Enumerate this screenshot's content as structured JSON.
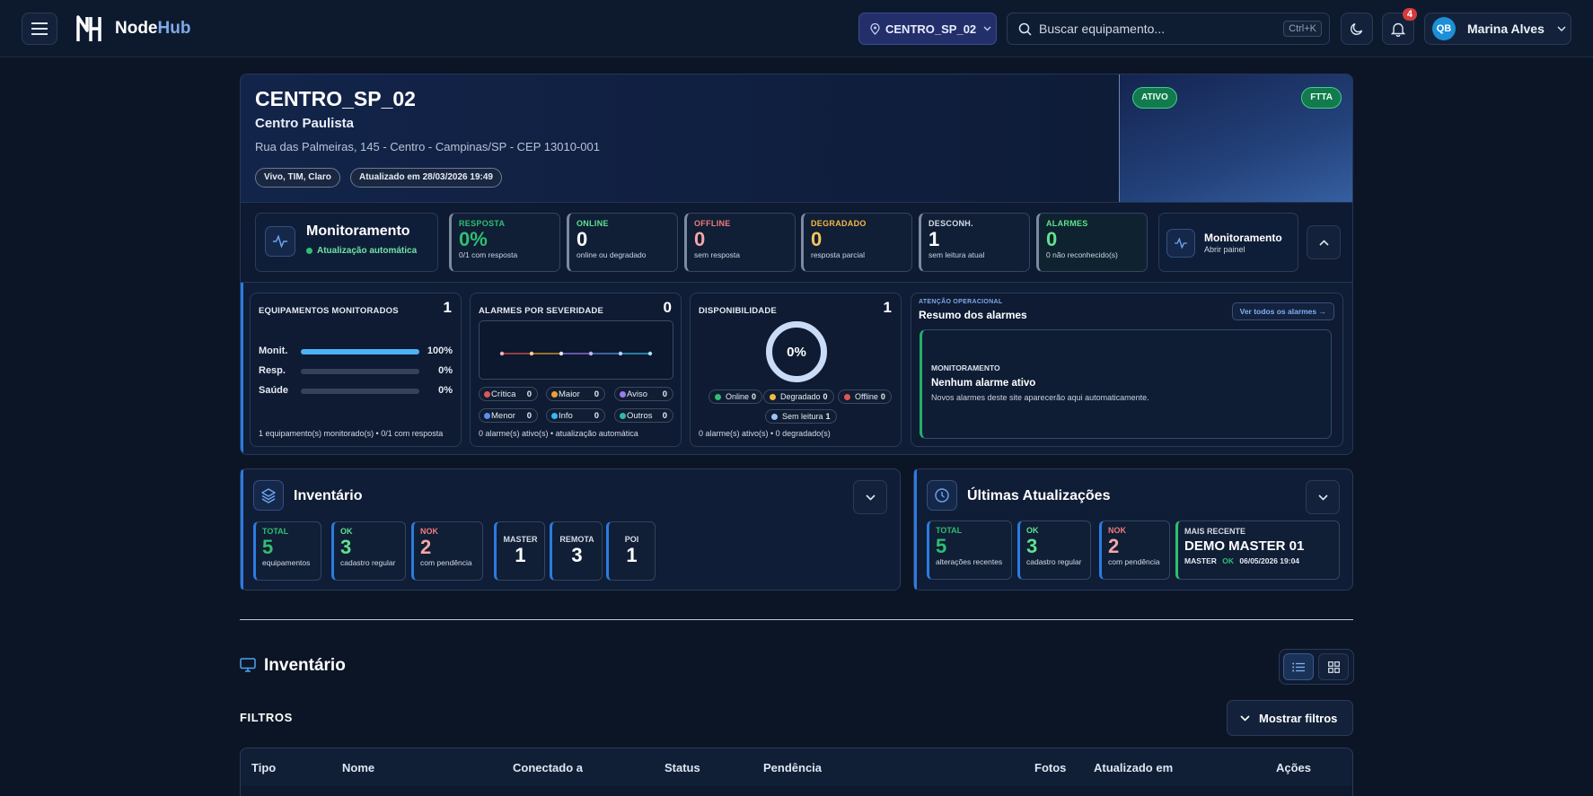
{
  "topbar": {
    "brand_prefix": "Node",
    "brand_suffix": "Hub",
    "site_selector": "CENTRO_SP_02",
    "search_placeholder": "Buscar equipamento...",
    "search_shortcut": "Ctrl+K",
    "notifications_count": "4",
    "user_initials": "QB",
    "user_name": "Marina Alves"
  },
  "site": {
    "code": "CENTRO_SP_02",
    "name": "Centro Paulista",
    "address": "Rua das Palmeiras, 145 - Centro - Campinas/SP - CEP 13010-001",
    "operators": "Vivo, TIM, Claro",
    "updated": "Atualizado em 28/03/2026 19:49",
    "status_badge": "ATIVO",
    "type_badge": "FTTA"
  },
  "monitoring": {
    "title": "Monitoramento",
    "status": "Atualização automática",
    "kpis": [
      {
        "label": "RESPOSTA",
        "value": "0%",
        "sub": "0/1 com resposta",
        "color": "#2fbf71"
      },
      {
        "label": "ONLINE",
        "value": "0",
        "sub": "online ou degradado",
        "color": "#5ee38f"
      },
      {
        "label": "OFFLINE",
        "value": "0",
        "sub": "sem resposta",
        "color": "#f07c7c"
      },
      {
        "label": "DEGRADADO",
        "value": "0",
        "sub": "resposta parcial",
        "color": "#f5b942"
      },
      {
        "label": "DESCONH.",
        "value": "1",
        "sub": "sem leitura atual",
        "color": "#d6dce6"
      },
      {
        "label": "ALARMES",
        "value": "0",
        "sub": "0 não reconhecido(s)",
        "color": "#5ee38f"
      }
    ],
    "panel_title": "Monitoramento",
    "panel_sub": "Abrir painel"
  },
  "equipment": {
    "title": "EQUIPAMENTOS MONITORADOS",
    "count": "1",
    "bars": [
      {
        "label": "Monit.",
        "value": "100%",
        "fraction": 1.0
      },
      {
        "label": "Resp.",
        "value": "0%",
        "fraction": 0
      },
      {
        "label": "Saúde",
        "value": "0%",
        "fraction": 0
      }
    ],
    "footer": "1 equipamento(s) monitorado(s) • 0/1 com resposta"
  },
  "severity": {
    "title": "ALARMES POR SEVERIDADE",
    "count": "0",
    "items": [
      {
        "label": "Crítica",
        "value": "0",
        "color": "#e05555"
      },
      {
        "label": "Maior",
        "value": "0",
        "color": "#f0a030"
      },
      {
        "label": "Aviso",
        "value": "0",
        "color": "#9b7bf0"
      },
      {
        "label": "Menor",
        "value": "0",
        "color": "#5b8ef0"
      },
      {
        "label": "Info",
        "value": "0",
        "color": "#38b7f0"
      },
      {
        "label": "Outros",
        "value": "0",
        "color": "#2fb9a0"
      }
    ],
    "footer": "0 alarme(s) ativo(s) • atualização automática"
  },
  "availability": {
    "title": "DISPONIBILIDADE",
    "count": "1",
    "percent": "0%",
    "items": [
      {
        "label": "Online",
        "value": "0",
        "color": "#2fbf71"
      },
      {
        "label": "Degradado",
        "value": "0",
        "color": "#f5b942"
      },
      {
        "label": "Offline",
        "value": "0",
        "color": "#e05555"
      },
      {
        "label": "Sem leitura",
        "value": "1",
        "color": "#9cc3f5"
      }
    ],
    "footer": "0 alarme(s) ativo(s) • 0 degradado(s)"
  },
  "alarms_summary": {
    "eyebrow": "ATENÇÃO OPERACIONAL",
    "title": "Resumo dos alarmes",
    "see_all": "Ver todos os alarmes →",
    "box_label": "MONITORAMENTO",
    "box_title": "Nenhum alarme ativo",
    "box_sub": "Novos alarmes deste site aparecerão aqui automaticamente."
  },
  "inventory_card": {
    "title": "Inventário",
    "stats": [
      {
        "label": "TOTAL",
        "value": "5",
        "sub": "equipamentos",
        "color": "#2fbf71"
      },
      {
        "label": "OK",
        "value": "3",
        "sub": "cadastro regular",
        "color": "#5ee38f"
      },
      {
        "label": "NOK",
        "value": "2",
        "sub": "com pendência",
        "color": "#f07c7c"
      },
      {
        "label": "MASTER",
        "value": "1",
        "sub": "",
        "color": "#d6dce6"
      },
      {
        "label": "REMOTA",
        "value": "3",
        "sub": "",
        "color": "#d6dce6"
      },
      {
        "label": "POI",
        "value": "1",
        "sub": "",
        "color": "#d6dce6"
      }
    ]
  },
  "updates_card": {
    "title": "Últimas Atualizações",
    "stats": [
      {
        "label": "TOTAL",
        "value": "5",
        "sub": "alterações recentes",
        "color": "#2fbf71"
      },
      {
        "label": "OK",
        "value": "3",
        "sub": "cadastro regular",
        "color": "#5ee38f"
      },
      {
        "label": "NOK",
        "value": "2",
        "sub": "com pendência",
        "color": "#f07c7c"
      }
    ],
    "recent_label": "MAIS RECENTE",
    "recent_name": "DEMO MASTER 01",
    "recent_type": "MASTER",
    "recent_status": "OK",
    "recent_date": "06/05/2026 19:04"
  },
  "inventory_section": {
    "title": "Inventário",
    "filters_label": "FILTROS",
    "show_filters": "Mostrar filtros",
    "columns": [
      "Tipo",
      "Nome",
      "Conectado a",
      "Status",
      "Pendência",
      "Fotos",
      "Atualizado em",
      "Ações"
    ]
  }
}
